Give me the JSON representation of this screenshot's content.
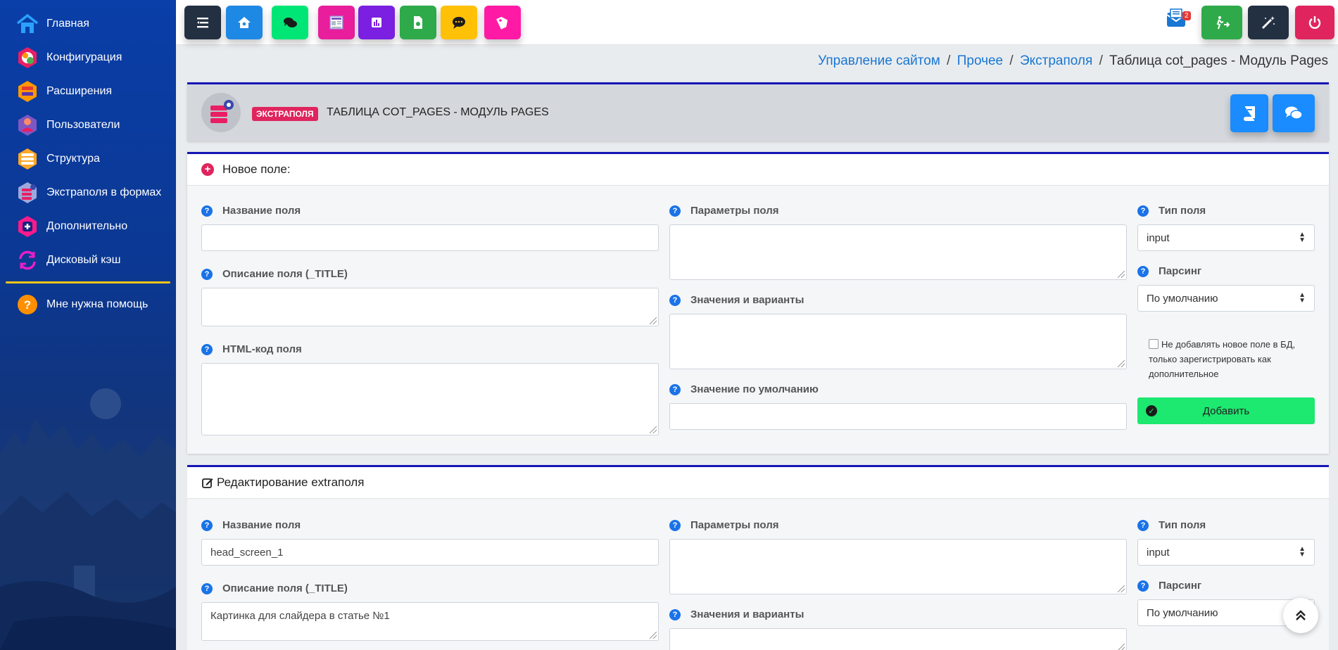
{
  "sidebar": {
    "items": [
      {
        "label": "Главная",
        "icon": "home-icon"
      },
      {
        "label": "Конфигурация",
        "icon": "config-icon"
      },
      {
        "label": "Расширения",
        "icon": "extensions-icon"
      },
      {
        "label": "Пользователи",
        "icon": "users-icon"
      },
      {
        "label": "Структура",
        "icon": "structure-icon"
      },
      {
        "label": "Экстраполя в формах",
        "icon": "extrafields-icon"
      },
      {
        "label": "Дополнительно",
        "icon": "plus-icon"
      },
      {
        "label": "Дисковый кэш",
        "icon": "refresh-icon"
      }
    ],
    "help": {
      "label": "Мне нужна помощь",
      "icon": "question-icon"
    }
  },
  "toolbar": {
    "buttons": [
      {
        "name": "menu-toggle-button",
        "icon": "menu-icon",
        "color": "#233042"
      },
      {
        "name": "home-button",
        "icon": "house-icon",
        "color": "#1e88e5"
      },
      {
        "name": "forums-button",
        "icon": "chat-icon",
        "color": "#00e676"
      },
      {
        "name": "pages-button",
        "icon": "newspaper-icon",
        "color": "#e91e9c"
      },
      {
        "name": "stats-button",
        "icon": "chart-icon",
        "color": "#7b1fe0"
      },
      {
        "name": "files-button",
        "icon": "file-icon",
        "color": "#2eaa4a"
      },
      {
        "name": "comments-button",
        "icon": "comment-icon",
        "color": "#ffc107"
      },
      {
        "name": "search-button",
        "icon": "tag-icon",
        "color": "#ff1aa6"
      }
    ],
    "right": [
      {
        "name": "messages-button",
        "icon": "mail-icon",
        "badge": "2"
      },
      {
        "name": "go-site-button",
        "icon": "exit-icon",
        "color": "#2eaa4a"
      },
      {
        "name": "magic-button",
        "icon": "wand-icon",
        "color": "#233042"
      },
      {
        "name": "logout-button",
        "icon": "power-icon",
        "color": "#e0245e"
      }
    ]
  },
  "breadcrumb": {
    "items": [
      "Управление сайтом",
      "Прочее",
      "Экстраполя"
    ],
    "current": "Таблица cot_pages - Модуль Pages",
    "separator": "/"
  },
  "title_card": {
    "badge": "ЭКСТРАПОЛЯ",
    "title": "ТАБЛИЦА COT_PAGES - МОДУЛЬ PAGES"
  },
  "new_field": {
    "header": "Новое поле:",
    "name_label": "Название поля",
    "name_value": "",
    "desc_label": "Описание поля (_TITLE)",
    "desc_value": "",
    "html_label": "HTML-код поля",
    "html_value": "",
    "params_label": "Параметры поля",
    "values_label": "Значения и варианты",
    "default_label": "Значение по умолчанию",
    "type_label": "Тип поля",
    "type_value": "input",
    "parse_label": "Парсинг",
    "parse_value": "По умолчанию",
    "checkbox_label": "Не добавлять новое поле в БД, только зарегистрировать как дополнительное",
    "add_button": "Добавить"
  },
  "edit_field": {
    "header": "Редактирование extraполя",
    "name_label": "Название поля",
    "name_value": "head_screen_1",
    "desc_label": "Описание поля (_TITLE)",
    "desc_value": "Картинка для слайдера в статье №1",
    "params_label": "Параметры поля",
    "values_label": "Значения и варианты",
    "type_label": "Тип поля",
    "type_value": "input",
    "parse_label": "Парсинг",
    "parse_value": "По умолчанию"
  },
  "colors": {
    "accent": "#1a73e8",
    "card_border": "#1515b5",
    "add_button": "#1de870",
    "badge": "#e0245e"
  }
}
